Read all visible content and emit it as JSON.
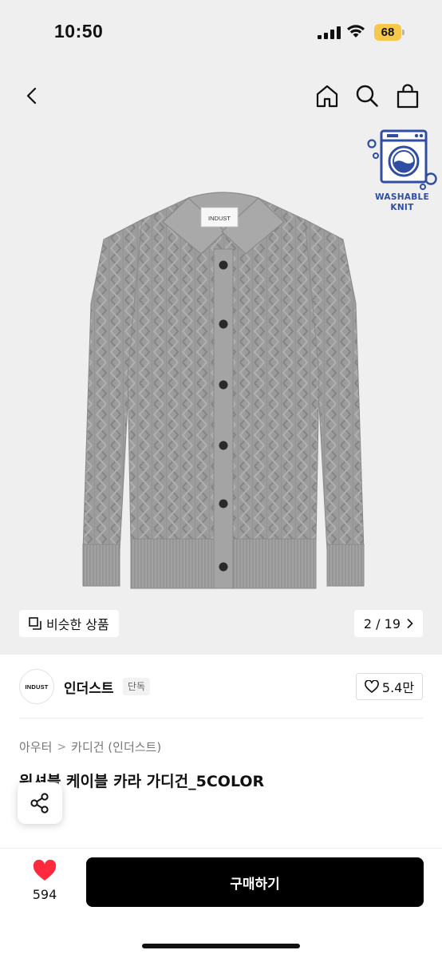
{
  "status_bar": {
    "time": "10:50",
    "battery_level": "68",
    "battery_color": "#f6c84a"
  },
  "nav": {
    "back_icon": "chevron-left-icon",
    "home_icon": "home-icon",
    "search_icon": "search-icon",
    "bag_icon": "shopping-bag-icon"
  },
  "badge": {
    "line1": "WASHABLE",
    "line2": "KNIT",
    "color": "#2f4ea3"
  },
  "product_image": {
    "logo_text": "INDUST",
    "similar_label": "비슷한 상품",
    "counter": "2 / 19"
  },
  "brand": {
    "logo_text": "INDUST",
    "name": "인더스트",
    "badge": "단독",
    "likes": "5.4만"
  },
  "breadcrumb": {
    "category": "아우터",
    "subcategory": "카디건 (인더스트)"
  },
  "product": {
    "title": "워셔블 케이블 카라 가디건_5COLOR"
  },
  "bottom_bar": {
    "wish_count": "594",
    "buy_label": "구매하기",
    "heart_color": "#ff2a3d",
    "button_color": "#000000"
  }
}
